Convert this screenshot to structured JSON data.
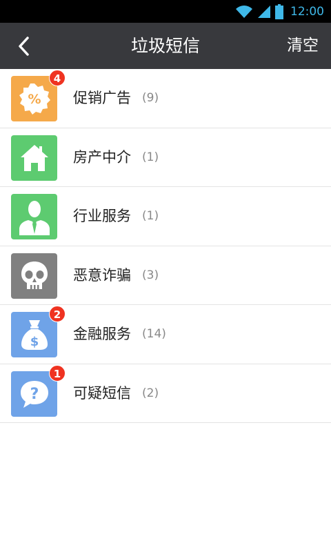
{
  "status": {
    "time": "12:00",
    "accent": "#3fb8e8"
  },
  "header": {
    "title": "垃圾短信",
    "clear_label": "清空",
    "bg": "#38393d"
  },
  "items": [
    {
      "label": "促销广告",
      "count": "(9)",
      "badge": "4",
      "icon": "percent-tag-icon",
      "color": "#f5a94a"
    },
    {
      "label": "房产中介",
      "count": "(1)",
      "badge": "",
      "icon": "house-icon",
      "color": "#5dcb70"
    },
    {
      "label": "行业服务",
      "count": "(1)",
      "badge": "",
      "icon": "businessman-icon",
      "color": "#5dcb70"
    },
    {
      "label": "恶意诈骗",
      "count": "(3)",
      "badge": "",
      "icon": "skull-icon",
      "color": "#808080"
    },
    {
      "label": "金融服务",
      "count": "(14)",
      "badge": "2",
      "icon": "money-bag-icon",
      "color": "#6fa3e8"
    },
    {
      "label": "可疑短信",
      "count": "(2)",
      "badge": "1",
      "icon": "question-bubble-icon",
      "color": "#6fa3e8"
    }
  ]
}
